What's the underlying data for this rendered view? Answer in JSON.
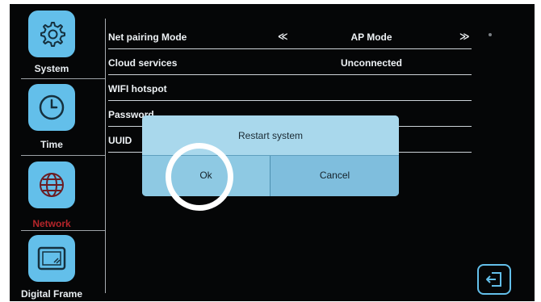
{
  "sidebar": {
    "items": [
      {
        "label": "System",
        "icon": "gear-icon",
        "active": false
      },
      {
        "label": "Time",
        "icon": "clock-icon",
        "active": false
      },
      {
        "label": "Network",
        "icon": "globe-icon",
        "active": true
      },
      {
        "label": "Digital Frame",
        "icon": "picture-frame-icon",
        "active": false
      }
    ]
  },
  "settings": {
    "rows": [
      {
        "label": "Net pairing Mode",
        "value": "AP Mode"
      },
      {
        "label": "Cloud services",
        "value": "Unconnected"
      },
      {
        "label": "WIFI hotspot",
        "value": ""
      },
      {
        "label": "Password",
        "value": ""
      },
      {
        "label": "UUID",
        "value": ""
      }
    ],
    "prev_arrow": "≪",
    "next_arrow": "≫"
  },
  "dialog": {
    "title": "Restart system",
    "ok_label": "Ok",
    "cancel_label": "Cancel"
  },
  "colors": {
    "accent": "#63bfea",
    "active_label": "#b5252a",
    "background": "#050607"
  }
}
